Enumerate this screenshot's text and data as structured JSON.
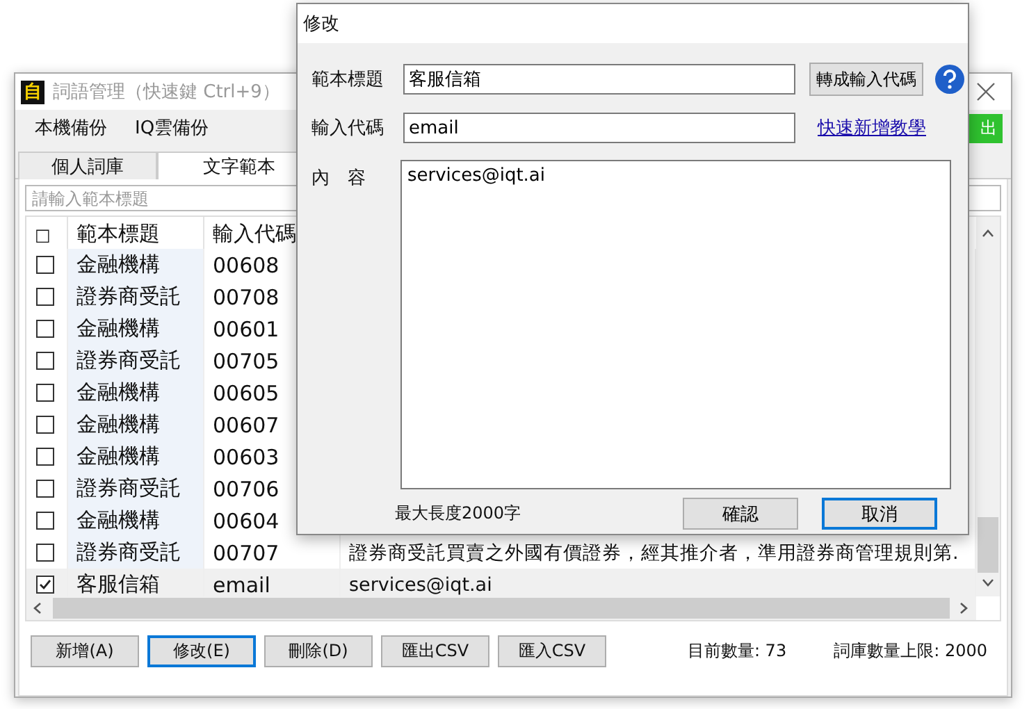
{
  "main_window": {
    "title": "詞語管理（快速鍵 Ctrl+9）",
    "logo": "自",
    "menu": [
      "本機備份",
      "IQ雲備份"
    ],
    "action_button": "出",
    "tabs": [
      {
        "label": "個人詞庫",
        "selected": false
      },
      {
        "label": "文字範本",
        "selected": true
      }
    ],
    "search": {
      "placeholder": "請輸入範本標題"
    },
    "table": {
      "select_all": "□",
      "columns": [
        "範本標題",
        "輸入代碼"
      ],
      "rows": [
        {
          "checked": false,
          "selected": false,
          "title": "金融機構",
          "code": "00608"
        },
        {
          "checked": false,
          "selected": false,
          "title": "證券商受託",
          "code": "00708"
        },
        {
          "checked": false,
          "selected": false,
          "title": "金融機構",
          "code": "00601"
        },
        {
          "checked": false,
          "selected": false,
          "title": "證券商受託",
          "code": "00705"
        },
        {
          "checked": false,
          "selected": false,
          "title": "金融機構",
          "code": "00605"
        },
        {
          "checked": false,
          "selected": false,
          "title": "金融機構",
          "code": "00607"
        },
        {
          "checked": false,
          "selected": false,
          "title": "金融機構",
          "code": "00603"
        },
        {
          "checked": false,
          "selected": false,
          "title": "證券商受託",
          "code": "00706"
        },
        {
          "checked": false,
          "selected": false,
          "title": "金融機構",
          "code": "00604"
        },
        {
          "checked": false,
          "selected": false,
          "title": "證券商受託",
          "code": "00707",
          "content": "證券商受託買賣之外國有價證券，經其推介者，準用證券商管理規則第."
        },
        {
          "checked": true,
          "selected": true,
          "title": "客服信箱",
          "code": "email",
          "content": "services@iqt.ai"
        }
      ]
    },
    "buttons": [
      {
        "label": "新增(A)",
        "focused": false
      },
      {
        "label": "修改(E)",
        "focused": true
      },
      {
        "label": "刪除(D)",
        "focused": false
      },
      {
        "label": "匯出CSV",
        "focused": false
      },
      {
        "label": "匯入CSV",
        "focused": false
      }
    ],
    "count": "目前數量: 73",
    "limit": "詞庫數量上限: 2000"
  },
  "dialog": {
    "title": "修改",
    "title_label": "範本標題",
    "title_value": "客服信箱",
    "convert_button": "轉成輸入代碼",
    "code_label": "輸入代碼",
    "code_value": "email",
    "tutorial_link": "快速新增教學",
    "content_label": "內　容",
    "content_value": "services@iqt.ai",
    "max_length": "最大長度2000字",
    "buttons": [
      {
        "label": "確認",
        "focused": false
      },
      {
        "label": "取消",
        "focused": true
      }
    ]
  }
}
